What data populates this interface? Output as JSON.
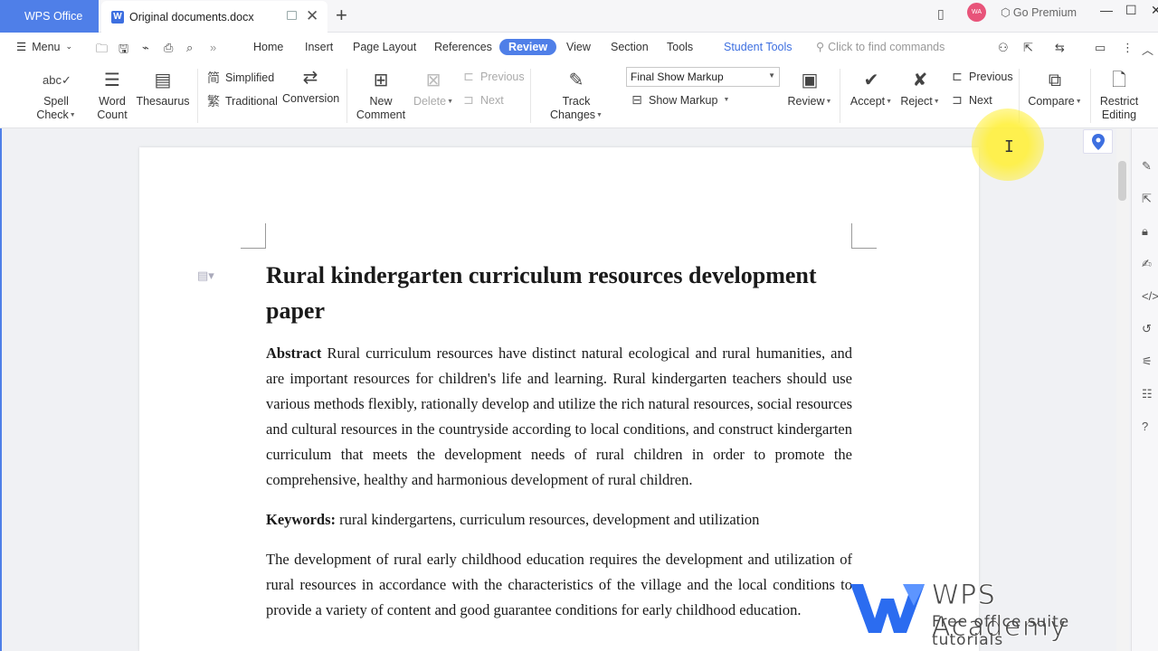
{
  "titlebar": {
    "app_tab": "WPS Office",
    "doc_tab": "Original documents.docx",
    "avatar_initials": "WA",
    "premium": "Go Premium"
  },
  "menubar": {
    "menu_label": "Menu",
    "tabs": [
      "Home",
      "Insert",
      "Page Layout",
      "References",
      "Review",
      "View",
      "Section",
      "Tools",
      "Student Tools"
    ],
    "active_tab": "Review",
    "search_placeholder": "Click to find commands"
  },
  "ribbon": {
    "spell_check": "Spell Check",
    "word_count_1": "Word",
    "word_count_2": "Count",
    "thesaurus": "Thesaurus",
    "simplified": "Simplified",
    "traditional": "Traditional",
    "conversion": "Conversion",
    "new_comment_1": "New",
    "new_comment_2": "Comment",
    "delete": "Delete",
    "previous_comment": "Previous",
    "next_comment": "Next",
    "track_changes": "Track Changes",
    "markup_mode": "Final Show Markup",
    "show_markup": "Show Markup",
    "review": "Review",
    "accept": "Accept",
    "reject": "Reject",
    "previous_change": "Previous",
    "next_change": "Next",
    "compare": "Compare",
    "restrict_1": "Restrict",
    "restrict_2": "Editing"
  },
  "document": {
    "title": "Rural kindergarten curriculum resources development paper",
    "abstract_label": "Abstract",
    "abstract_text": " Rural curriculum resources have distinct natural ecological and rural humanities, and are important resources for children's life and learning. Rural kindergarten teachers should use various methods flexibly, rationally develop and utilize the rich natural resources, social resources and cultural resources in the countryside according to local conditions, and construct kindergarten curriculum that meets the development needs of rural children in order to promote the comprehensive, healthy and harmonious development of rural children.",
    "keywords_label": "Keywords:",
    "keywords_text": " rural kindergartens, curriculum resources, development and utilization",
    "body_text": "The development of rural early childhood education requires the development and utilization of rural resources in accordance with the characteristics of the village and the local conditions to provide a variety of content and good guarantee conditions for early childhood education."
  },
  "watermark": {
    "title": "WPS Academy",
    "subtitle": "Free office suite tutorials"
  },
  "colors": {
    "accent": "#4f7fe8",
    "avatar": "#e8547a"
  }
}
